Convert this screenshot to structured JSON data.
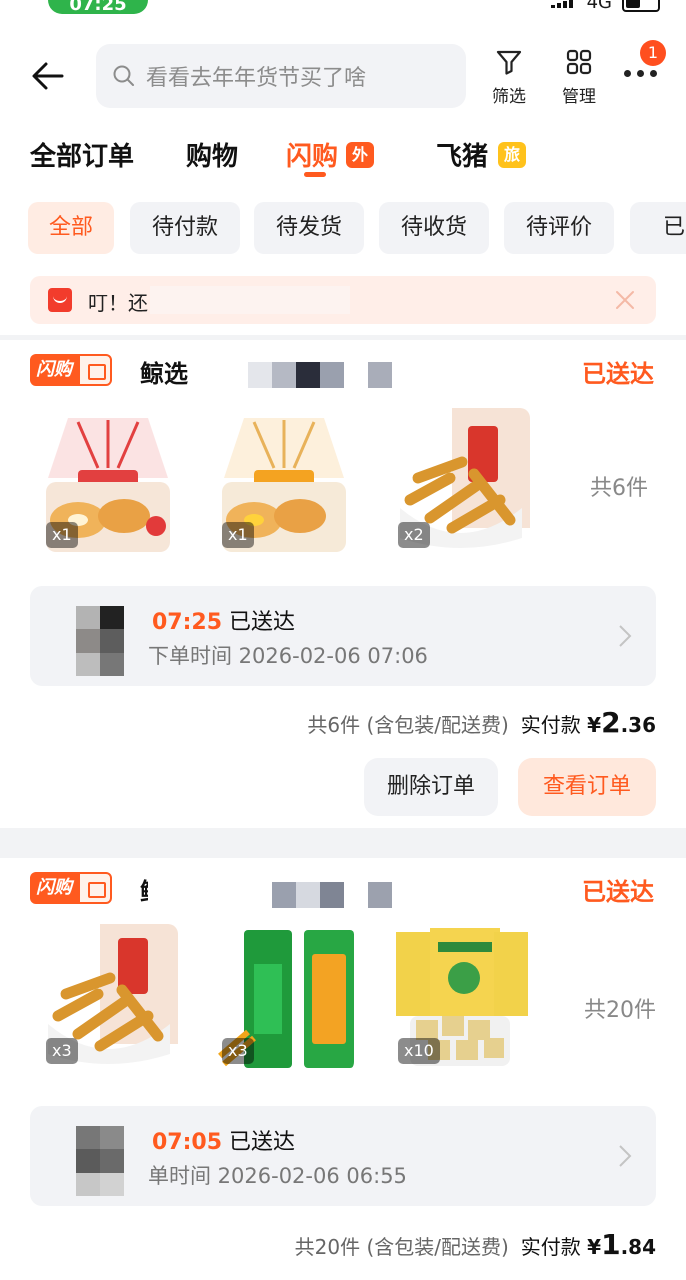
{
  "status_bar": {
    "time": "07:25",
    "network": "4G"
  },
  "header": {
    "search_placeholder": "看看去年年货节买了啥",
    "filter_label": "筛选",
    "manage_label": "管理",
    "more_badge": "1"
  },
  "tabs": [
    {
      "label": "全部订单"
    },
    {
      "label": "购物"
    },
    {
      "label": "闪购",
      "tag": "外卖"
    },
    {
      "label": "飞猪",
      "tag": "旅行"
    }
  ],
  "chips": [
    "全部",
    "待付款",
    "待发货",
    "待收货",
    "待评价",
    "已关"
  ],
  "notice": {
    "text": "叮！还"
  },
  "orders": [
    {
      "brand_tag": "闪购",
      "shop": "鲸选",
      "status": "已送达",
      "items": [
        {
          "qty": "x1",
          "icon": "bread-pack"
        },
        {
          "qty": "x1",
          "icon": "bread-pack"
        },
        {
          "qty": "x2",
          "icon": "sweet-rice-sticks"
        }
      ],
      "count_label": "共6件",
      "delivery_time": "07:25",
      "delivery_text": "已送达",
      "order_time": "下单时间 2026-02-06 07:06",
      "summary": "共6件 (含包装/配送费)",
      "paid_label": "实付款",
      "currency": "¥",
      "amount_int": "2",
      "amount_dec": ".36",
      "btn_delete": "删除订单",
      "btn_view": "查看订单"
    },
    {
      "brand_tag": "闪购",
      "shop": "鲸选",
      "status": "已送达",
      "items": [
        {
          "qty": "x3",
          "icon": "sweet-rice-sticks"
        },
        {
          "qty": "x3",
          "icon": "green-snack-pack"
        },
        {
          "qty": "x10",
          "icon": "mung-bean-cake"
        }
      ],
      "count_label": "共20件",
      "delivery_time": "07:05",
      "delivery_text": "已送达",
      "order_time": "单时间 2026-02-06 06:55",
      "summary": "共20件 (含包装/配送费)",
      "paid_label": "实付款",
      "currency": "¥",
      "amount_int": "1",
      "amount_dec": ".84"
    }
  ],
  "colors": {
    "accent": "#ff5a1f",
    "tag_yellow": "#ffc21c",
    "bg": "#f2f3f5"
  }
}
